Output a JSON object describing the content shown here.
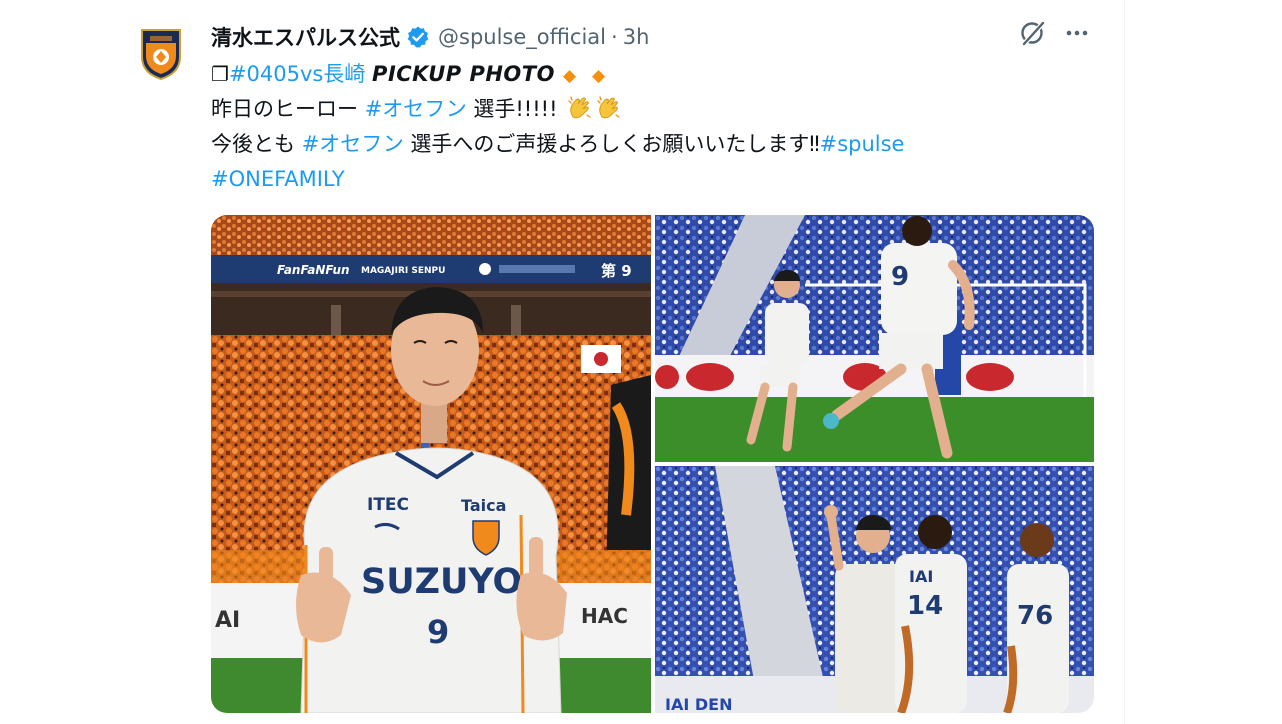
{
  "tweet": {
    "display_name": "清水エスパルス公式",
    "handle": "@spulse_official",
    "separator": "·",
    "timestamp": "3h",
    "text": {
      "line1": {
        "prefix_glyph": "❐",
        "hashtag_match": "#0405vs長崎",
        "pickup_label": "PICKUP PHOTO",
        "diamond1": "◆",
        "diamond2": "◆"
      },
      "line2": {
        "prefix": "昨日のヒーロー",
        "hashtag": "#オセフン",
        "suffix": "選手!!!!!"
      },
      "line3": {
        "prefix": "今後とも",
        "hashtag": "#オセフン",
        "middle": "選手へのご声援よろしくお願いいたします‼",
        "hashtag_end": "#spulse"
      },
      "line4": {
        "hashtag": "#ONEFAMILY"
      }
    }
  },
  "media": {
    "photo1": {
      "banner_text": "MAGAJIRI SENPU",
      "banner_number": "第 9",
      "sponsor1": "ITEC",
      "sponsor2": "Taica",
      "shirt_sponsor": "SUZUYO",
      "shirt_number": "9",
      "board_left": "AI",
      "board_right": "HAC"
    },
    "photo2": {
      "player_number": "9"
    },
    "photo3": {
      "player_number": "14",
      "player_number_right": "76",
      "name_label": "IAI"
    }
  },
  "icons": {
    "verified": "verified-badge-icon",
    "grok": "grok-icon",
    "more": "more-options-icon",
    "clap": "clapping-hands-emoji-icon",
    "avatar": "spulse-crest-avatar"
  },
  "colors": {
    "hashtag": "#1d9bf0",
    "verified": "#1d9bf0",
    "secondary_text": "#536471",
    "diamond": "#f4900c",
    "club_orange": "#f08a1c"
  }
}
